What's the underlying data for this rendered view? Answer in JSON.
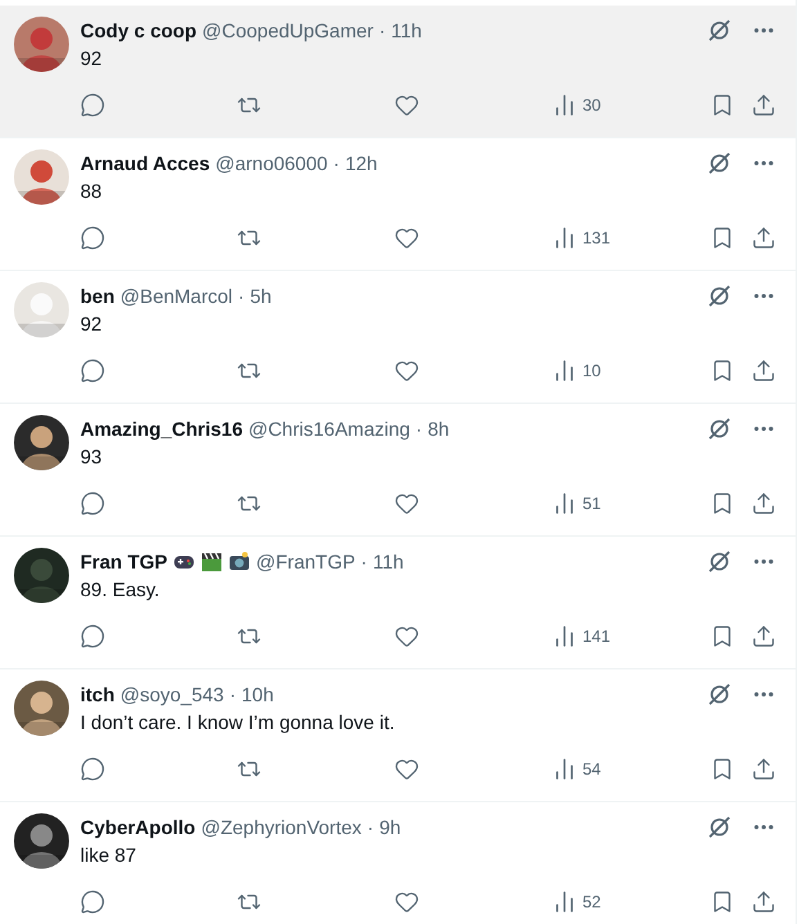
{
  "replies": [
    {
      "name": "Cody c coop",
      "handle": "@CoopedUpGamer",
      "time": "11h",
      "text": "92",
      "views": "30",
      "hovered": true
    },
    {
      "name": "Arnaud Acces",
      "handle": "@arno06000",
      "time": "12h",
      "text": "88",
      "views": "131",
      "hovered": false
    },
    {
      "name": "ben",
      "handle": "@BenMarcol",
      "time": "5h",
      "text": "92",
      "views": "10",
      "hovered": false
    },
    {
      "name": "Amazing_Chris16",
      "handle": "@Chris16Amazing",
      "time": "8h",
      "text": "93",
      "views": "51",
      "hovered": false
    },
    {
      "name": "Fran TGP",
      "badges": [
        {
          "kind": "gamepad"
        },
        {
          "kind": "clapper"
        },
        {
          "kind": "camera"
        }
      ],
      "handle": "@FranTGP",
      "time": "11h",
      "text": "89. Easy.",
      "views": "141",
      "hovered": false
    },
    {
      "name": "itch",
      "handle": "@soyo_543",
      "time": "10h",
      "text": "I don’t care. I know I’m gonna love it.",
      "views": "54",
      "hovered": false
    },
    {
      "name": "CyberApollo",
      "handle": "@ZephyrionVortex",
      "time": "9h",
      "text": "like 87",
      "views": "52",
      "hovered": false
    }
  ],
  "separator": "·"
}
